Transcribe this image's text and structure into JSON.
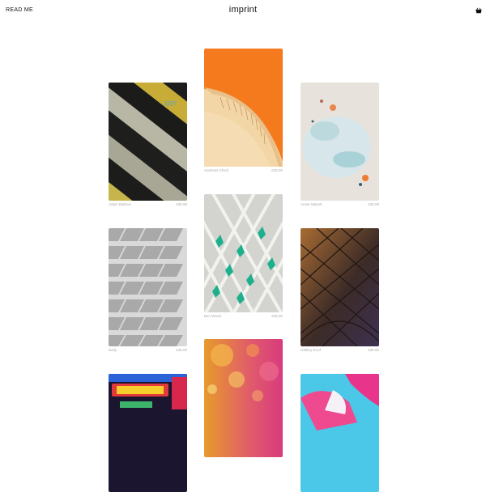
{
  "header": {
    "readme_label": "READ ME",
    "logo": "imprint",
    "cart_icon": "basket-icon"
  },
  "products": [
    {
      "name": "Adam Balloon",
      "price": "£35.00",
      "art": "yellow-black-stripes-wall"
    },
    {
      "name": "Andrews Chick",
      "price": "£35.00",
      "art": "orange-architecture"
    },
    {
      "name": "Annie Splash",
      "price": "£35.00",
      "art": "pastel-watercolor"
    },
    {
      "name": "Daily",
      "price": "£35.00",
      "art": "white-facade-grid"
    },
    {
      "name": "Ben Wood",
      "price": "£35.00",
      "art": "teal-diamond-facade"
    },
    {
      "name": "Gallery Roof",
      "price": "£35.00",
      "art": "bronze-roof-lattice"
    },
    {
      "name": "",
      "price": "",
      "art": "neon-sign"
    },
    {
      "name": "",
      "price": "",
      "art": "orange-bubbles"
    },
    {
      "name": "",
      "price": "",
      "art": "colorful-paint-splash"
    }
  ]
}
